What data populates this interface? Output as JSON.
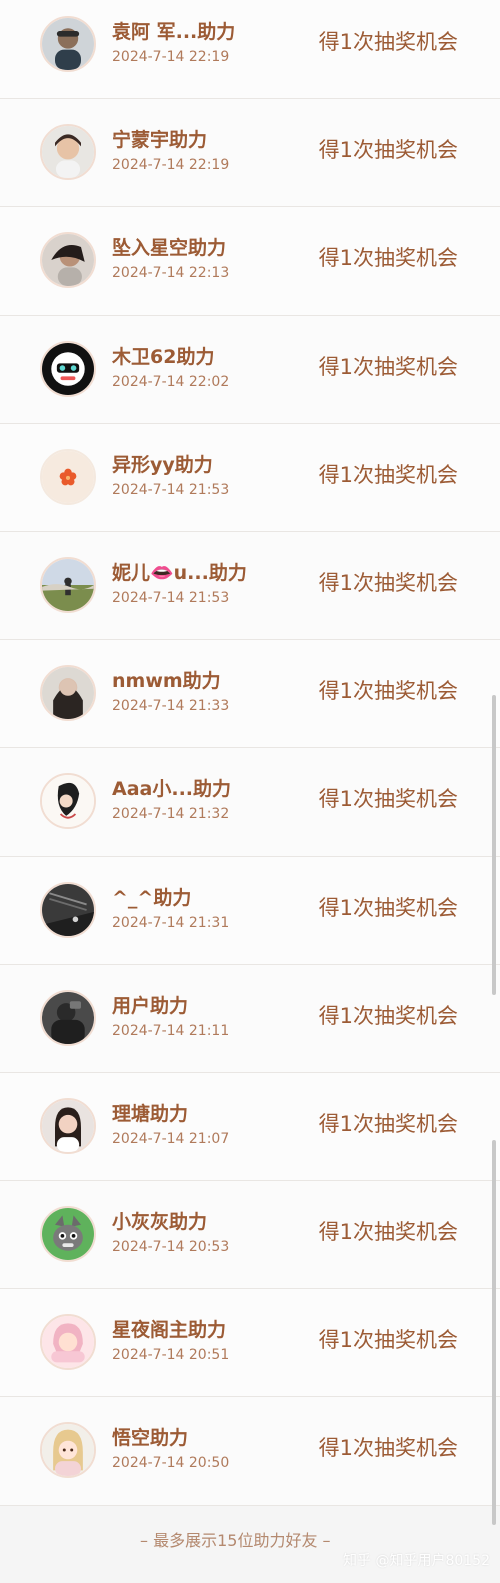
{
  "items": [
    {
      "name": "袁阿 军...助力",
      "time": "2024-7-14 22:19",
      "reward": "得1次抽奖机会",
      "avatar": "person-photo-icon"
    },
    {
      "name": "宁蒙宇助力",
      "time": "2024-7-14 22:19",
      "reward": "得1次抽奖机会",
      "avatar": "person-photo-icon"
    },
    {
      "name": "坠入星空助力",
      "time": "2024-7-14 22:13",
      "reward": "得1次抽奖机会",
      "avatar": "person-photo-icon"
    },
    {
      "name": "木卫62助力",
      "time": "2024-7-14 22:02",
      "reward": "得1次抽奖机会",
      "avatar": "character-icon"
    },
    {
      "name": "异形yy助力",
      "time": "2024-7-14 21:53",
      "reward": "得1次抽奖机会",
      "avatar": "flower-icon"
    },
    {
      "name": "妮儿👄u...助力",
      "time": "2024-7-14 21:53",
      "reward": "得1次抽奖机会",
      "avatar": "landscape-photo-icon"
    },
    {
      "name": "nmwm助力",
      "time": "2024-7-14 21:33",
      "reward": "得1次抽奖机会",
      "avatar": "person-photo-icon"
    },
    {
      "name": "Aaa小...助力",
      "time": "2024-7-14 21:32",
      "reward": "得1次抽奖机会",
      "avatar": "illustration-icon"
    },
    {
      "name": "^_^助力",
      "time": "2024-7-14 21:31",
      "reward": "得1次抽奖机会",
      "avatar": "dark-photo-icon"
    },
    {
      "name": "用户助力",
      "time": "2024-7-14 21:11",
      "reward": "得1次抽奖机会",
      "avatar": "dark-photo-icon"
    },
    {
      "name": "理塘助力",
      "time": "2024-7-14 21:07",
      "reward": "得1次抽奖机会",
      "avatar": "person-photo-icon"
    },
    {
      "name": "小灰灰助力",
      "time": "2024-7-14 20:53",
      "reward": "得1次抽奖机会",
      "avatar": "cartoon-wolf-icon"
    },
    {
      "name": "星夜阁主助力",
      "time": "2024-7-14 20:51",
      "reward": "得1次抽奖机会",
      "avatar": "cartoon-girl-icon"
    },
    {
      "name": "悟空助力",
      "time": "2024-7-14 20:50",
      "reward": "得1次抽奖机会",
      "avatar": "cartoon-girl-icon"
    }
  ],
  "footer_note": "– 最多展示15位助力好友 –",
  "watermark": "知乎 @知乎用户80152",
  "colors": {
    "accent": "#9c5b35",
    "time_text": "#b07a5b",
    "page_bg": "#f5f5f5"
  }
}
